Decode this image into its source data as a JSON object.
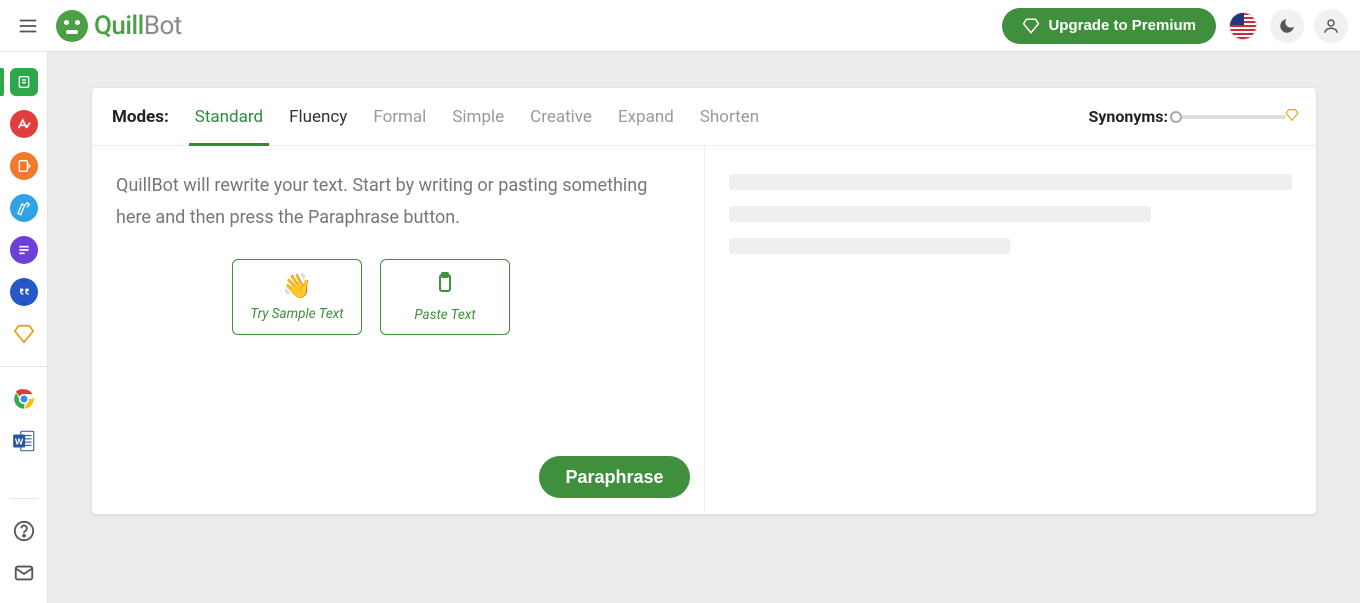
{
  "brand": {
    "part1": "Quill",
    "part2": "Bot"
  },
  "topbar": {
    "premium_label": "Upgrade to Premium"
  },
  "modes": {
    "label": "Modes:",
    "tabs": [
      {
        "label": "Standard",
        "active": true,
        "enabled": true
      },
      {
        "label": "Fluency",
        "active": false,
        "enabled": true
      },
      {
        "label": "Formal",
        "active": false,
        "enabled": false
      },
      {
        "label": "Simple",
        "active": false,
        "enabled": false
      },
      {
        "label": "Creative",
        "active": false,
        "enabled": false
      },
      {
        "label": "Expand",
        "active": false,
        "enabled": false
      },
      {
        "label": "Shorten",
        "active": false,
        "enabled": false
      }
    ]
  },
  "synonyms": {
    "label": "Synonyms:"
  },
  "editor": {
    "placeholder": "QuillBot will rewrite your text. Start by writing or pasting something here and then press the Paraphrase button.",
    "sample_label": "Try Sample Text",
    "paste_label": "Paste Text",
    "paraphrase_label": "Paraphrase"
  },
  "left_rail": {
    "items": [
      {
        "name": "paraphraser-icon"
      },
      {
        "name": "grammar-icon"
      },
      {
        "name": "cowriter-icon"
      },
      {
        "name": "plagiarism-icon"
      },
      {
        "name": "summarizer-icon"
      },
      {
        "name": "citation-icon"
      },
      {
        "name": "premium-icon"
      },
      {
        "name": "chrome-ext-icon"
      },
      {
        "name": "word-ext-icon"
      }
    ]
  }
}
